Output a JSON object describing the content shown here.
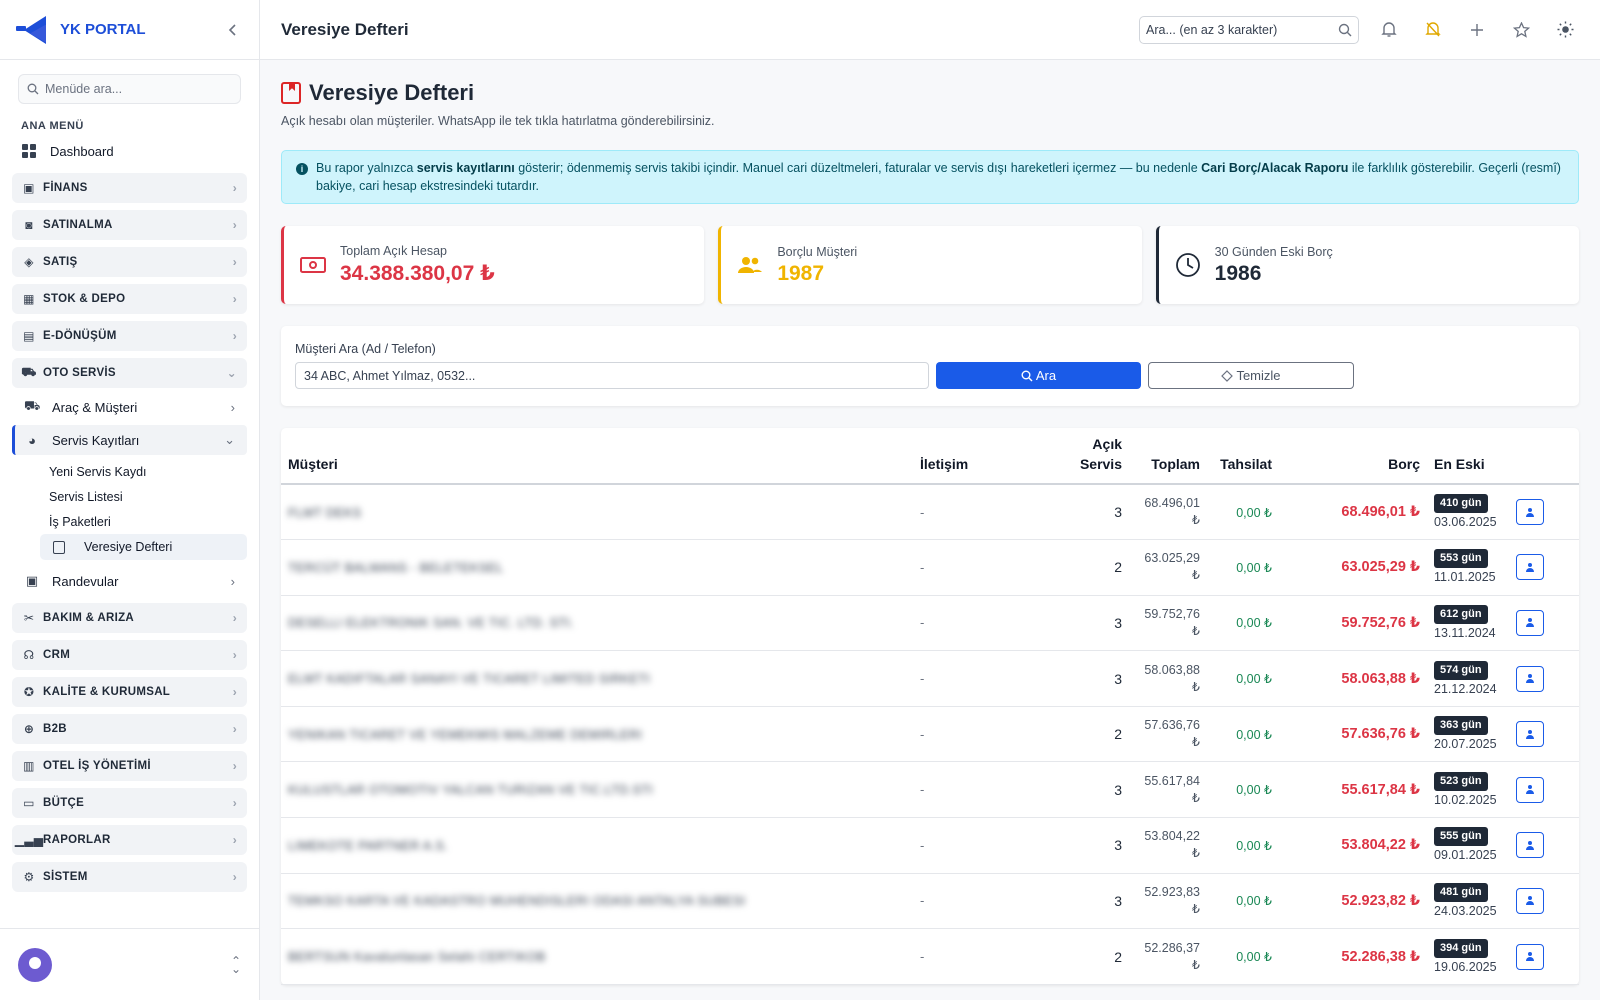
{
  "brand": {
    "name": "YK PORTAL"
  },
  "sidebar": {
    "search_placeholder": "Menüde ara...",
    "section_label": "ANA MENÜ",
    "dashboard": "Dashboard",
    "groups_top": [
      {
        "label": "FİNANS",
        "icon": "money-icon"
      },
      {
        "label": "SATINALMA",
        "icon": "bag-icon"
      },
      {
        "label": "SATIŞ",
        "icon": "tag-icon"
      },
      {
        "label": "STOK & DEPO",
        "icon": "box-icon"
      },
      {
        "label": "E-DÖNÜŞÜM",
        "icon": "document-icon"
      }
    ],
    "oto_servis": {
      "label": "OTO SERVİS",
      "arac": "Araç & Müşteri",
      "servis": "Servis Kayıtları",
      "servis_items": [
        "Yeni Servis Kaydı",
        "Servis Listesi",
        "İş Paketleri"
      ],
      "veresiye": "Veresiye Defteri",
      "randevular": "Randevular"
    },
    "groups_bottom": [
      {
        "label": "BAKIM & ARIZA",
        "icon": "tools-icon"
      },
      {
        "label": "CRM",
        "icon": "headset-icon"
      },
      {
        "label": "KALİTE & KURUMSAL",
        "icon": "award-icon"
      },
      {
        "label": "B2B",
        "icon": "globe-icon"
      },
      {
        "label": "OTEL İŞ YÖNETİMİ",
        "icon": "building-icon"
      },
      {
        "label": "BÜTÇE",
        "icon": "wallet-icon"
      },
      {
        "label": "RAPORLAR",
        "icon": "bar-chart-icon"
      },
      {
        "label": "SİSTEM",
        "icon": "gear-icon"
      }
    ]
  },
  "topbar": {
    "title": "Veresiye Defteri",
    "search_placeholder": "Ara... (en az 3 karakter)"
  },
  "page": {
    "title": "Veresiye Defteri",
    "description": "Açık hesabı olan müşteriler. WhatsApp ile tek tıkla hatırlatma gönderebilirsiniz.",
    "alert": {
      "t1": "Bu rapor yalnızca ",
      "b1": "servis kayıtlarını",
      "t2": " gösterir; ödenmemiş servis takibi içindir. Manuel cari düzeltmeleri, faturalar ve servis dışı hareketleri içermez — bu nedenle ",
      "b2": "Cari Borç/Alacak Raporu",
      "t3": " ile farklılık gösterebilir. Geçerli (resmî) bakiye, cari hesap ekstresindeki tutardır."
    }
  },
  "stats": [
    {
      "label": "Toplam Açık Hesap",
      "value": "34.388.380,07 ₺",
      "color": "#dc3545",
      "icon": "cash-icon"
    },
    {
      "label": "Borçlu Müşteri",
      "value": "1987",
      "color": "#f0b400",
      "icon": "people-icon"
    },
    {
      "label": "30 Günden Eski Borç",
      "value": "1986",
      "color": "#1f2937",
      "icon": "clock-icon"
    }
  ],
  "filter": {
    "label": "Müşteri Ara (Ad / Telefon)",
    "placeholder": "34 ABC, Ahmet Yılmaz, 0532...",
    "search_button": "Ara",
    "clear_button": "Temizle"
  },
  "table": {
    "headers": {
      "customer": "Müşteri",
      "contact": "İletişim",
      "open1": "Açık",
      "open2": "Servis",
      "total": "Toplam",
      "collected": "Tahsilat",
      "debt": "Borç",
      "oldest": "En Eski"
    },
    "rows": [
      {
        "customer": "FLMT DEKS",
        "contact": "-",
        "open": "3",
        "total1": "68.496,01",
        "total2": "₺",
        "collected": "0,00 ₺",
        "debt": "68.496,01 ₺",
        "days": "410 gün",
        "date": "03.06.2025"
      },
      {
        "customer": "TERCÜT BALMANS - BELETEKSEL",
        "contact": "-",
        "open": "2",
        "total1": "63.025,29",
        "total2": "₺",
        "collected": "0,00 ₺",
        "debt": "63.025,29 ₺",
        "days": "553 gün",
        "date": "11.01.2025"
      },
      {
        "customer": "DESELLI ELEKTRONIK SAN. VE TIC. LTD. STI.",
        "contact": "-",
        "open": "3",
        "total1": "59.752,76",
        "total2": "₺",
        "collected": "0,00 ₺",
        "debt": "59.752,76 ₺",
        "days": "612 gün",
        "date": "13.11.2024"
      },
      {
        "customer": "ELMT KADIFTALAR SANAYI VE TICARET LIMITED SIRKETI",
        "contact": "-",
        "open": "3",
        "total1": "58.063,88",
        "total2": "₺",
        "collected": "0,00 ₺",
        "debt": "58.063,88 ₺",
        "days": "574 gün",
        "date": "21.12.2024"
      },
      {
        "customer": "YENIKAN TICARET VE YEMEKMIS MALZEME DEMIRLERI",
        "contact": "-",
        "open": "2",
        "total1": "57.636,76",
        "total2": "₺",
        "collected": "0,00 ₺",
        "debt": "57.636,76 ₺",
        "days": "363 gün",
        "date": "20.07.2025"
      },
      {
        "customer": "KULUSTLAR OTOMOTIV YALCAN TURIZAN VE TIC.LTD.STI",
        "contact": "-",
        "open": "3",
        "total1": "55.617,84",
        "total2": "₺",
        "collected": "0,00 ₺",
        "debt": "55.617,84 ₺",
        "days": "523 gün",
        "date": "10.02.2025"
      },
      {
        "customer": "LIMEKOTE PARTNER A.S.",
        "contact": "-",
        "open": "3",
        "total1": "53.804,22",
        "total2": "₺",
        "collected": "0,00 ₺",
        "debt": "53.804,22 ₺",
        "days": "555 gün",
        "date": "09.01.2025"
      },
      {
        "customer": "TEMKSO KARTA VE KADASTRO MUHENDISLERI ODASI ANTALYA SUBESI",
        "contact": "-",
        "open": "3",
        "total1": "52.923,83",
        "total2": "₺",
        "collected": "0,00 ₺",
        "debt": "52.923,82 ₺",
        "days": "481 gün",
        "date": "24.03.2025"
      },
      {
        "customer": "BERTSUN Kavalunlasan Selahi CERTIKOB",
        "contact": "-",
        "open": "2",
        "total1": "52.286,37",
        "total2": "₺",
        "collected": "0,00 ₺",
        "debt": "52.286,38 ₺",
        "days": "394 gün",
        "date": "19.06.2025"
      }
    ]
  }
}
